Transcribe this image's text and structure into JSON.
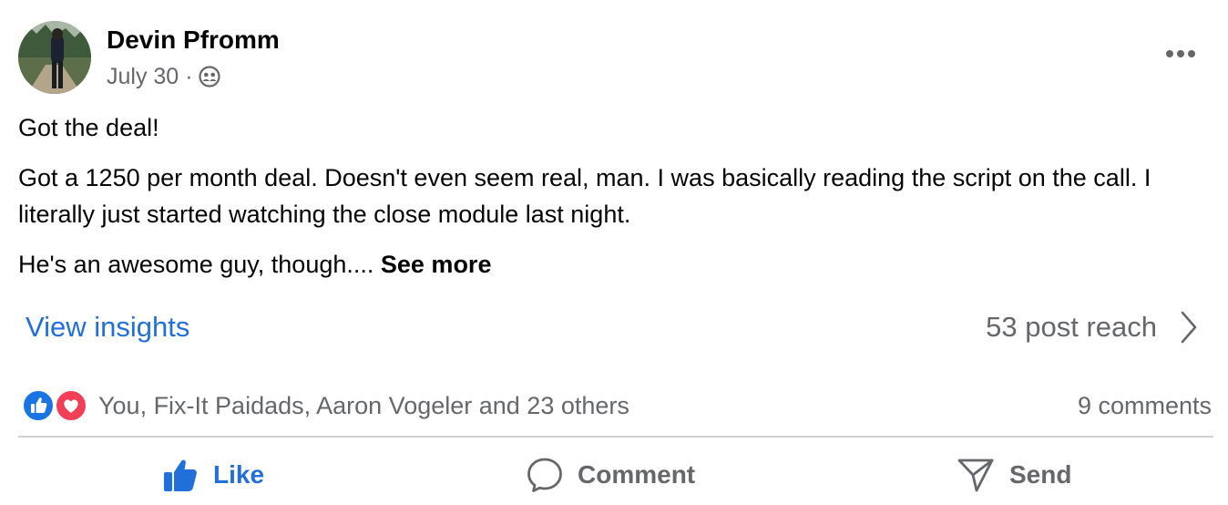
{
  "post": {
    "author": "Devin Pfromm",
    "date": "July 30",
    "separator": "·",
    "audience_icon": "friends-icon",
    "more_icon": "more-dots-icon",
    "paragraphs": [
      "Got the deal!",
      "Got a 1250 per month deal. Doesn't even seem real, man. I was basically reading the script on the call. I literally just started watching the close module last night.",
      "He's an awesome guy, though.... "
    ],
    "see_more": "See more"
  },
  "insights": {
    "link": "View insights",
    "reach": "53 post reach",
    "chevron_icon": "chevron-right-icon"
  },
  "reactions": {
    "icons": [
      "like-reaction-icon",
      "love-reaction-icon"
    ],
    "names": "You, Fix-It Paidads, Aaron Vogeler and 23 others",
    "comments": "9 comments"
  },
  "actions": {
    "like": "Like",
    "comment": "Comment",
    "send": "Send"
  },
  "colors": {
    "accent_blue": "#216fdb",
    "secondary_text": "#65676b",
    "love_red": "#f33e58",
    "divider": "#ced0d4"
  }
}
